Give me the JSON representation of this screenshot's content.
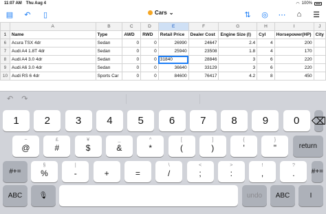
{
  "status": {
    "time": "11:07 AM",
    "date": "Thu Aug 4",
    "battery": "100%"
  },
  "toolbar": {
    "title": "Cars",
    "title_chevron": "⌄",
    "left_icons": [
      "sidebar-icon",
      "undo-icon",
      "document-icon"
    ],
    "right_icons": [
      "sort-icon",
      "view-icon",
      "more-icon",
      "bank-icon",
      "account-icon"
    ]
  },
  "sheet": {
    "columns": [
      "A",
      "B",
      "C",
      "D",
      "E",
      "F",
      "G",
      "H",
      "I",
      "J"
    ],
    "selected_column": "E",
    "header": {
      "row_num": "1",
      "cells": [
        "Name",
        "Type",
        "AWD",
        "RWD",
        "Retail Price",
        "Dealer Cost",
        "Engine Size (l)",
        "Cyl",
        "Horsepower(HP)",
        "City"
      ]
    },
    "rows": [
      {
        "row_num": "6",
        "cells": [
          "Acura TSX 4dr",
          "Sedan",
          "0",
          "0",
          "26990",
          "24647",
          "2.4",
          "4",
          "200",
          ""
        ]
      },
      {
        "row_num": "7",
        "cells": [
          "Audi A4 1.8T 4dr",
          "Sedan",
          "0",
          "0",
          "25940",
          "23508",
          "1.8",
          "4",
          "170",
          ""
        ]
      },
      {
        "row_num": "8",
        "cells": [
          "Audi A4 3.0 4dr",
          "Sedan",
          "0",
          "0",
          "31840",
          "28846",
          "3",
          "6",
          "220",
          ""
        ]
      },
      {
        "row_num": "9",
        "cells": [
          "Audi A6 3.0 4dr",
          "Sedan",
          "0",
          "0",
          "36640",
          "33129",
          "3",
          "6",
          "220",
          ""
        ]
      },
      {
        "row_num": "10",
        "cells": [
          "Audi RS 6 4dr",
          "Sports Car",
          "0",
          "0",
          "84600",
          "76417",
          "4.2",
          "8",
          "450",
          ""
        ]
      }
    ]
  },
  "accessory": {
    "undo": "↶",
    "redo": "↷"
  },
  "keyboard": {
    "row1": [
      {
        "top": "",
        "main": "1"
      },
      {
        "top": "",
        "main": "2"
      },
      {
        "top": "",
        "main": "3"
      },
      {
        "top": "",
        "main": "4"
      },
      {
        "top": "",
        "main": "5"
      },
      {
        "top": "",
        "main": "6"
      },
      {
        "top": "",
        "main": "7"
      },
      {
        "top": "",
        "main": "8"
      },
      {
        "top": "",
        "main": "9"
      },
      {
        "top": "",
        "main": "0"
      }
    ],
    "delete": "⌫",
    "row2": [
      {
        "top": "~",
        "main": "@"
      },
      {
        "top": "£",
        "main": "#"
      },
      {
        "top": "¥",
        "main": "$"
      },
      {
        "top": "_",
        "main": "&"
      },
      {
        "top": "^",
        "main": "*"
      },
      {
        "top": "[",
        "main": "("
      },
      {
        "top": "]",
        "main": ")"
      },
      {
        "top": "{",
        "main": "'"
      },
      {
        "top": "}",
        "main": "\""
      }
    ],
    "return": "return",
    "shift_sym": "#+=",
    "row3": [
      {
        "top": "§",
        "main": "%"
      },
      {
        "top": "|",
        "main": "-"
      },
      {
        "top": "",
        "main": "+"
      },
      {
        "top": "",
        "main": "="
      },
      {
        "top": "\\",
        "main": "/"
      },
      {
        "top": "<",
        "main": ";"
      },
      {
        "top": ">",
        "main": ":"
      },
      {
        "top": "!",
        "main": ","
      },
      {
        "top": "?",
        "main": "."
      }
    ],
    "abc": "ABC",
    "mic": "🎙",
    "undo": "undo",
    "cursor": "I"
  }
}
